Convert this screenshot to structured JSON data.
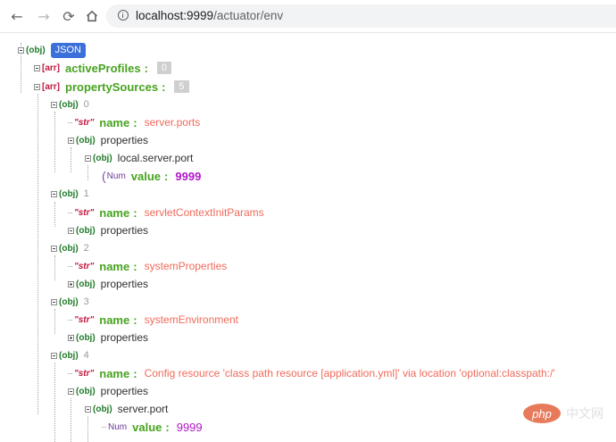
{
  "browser": {
    "back_icon": "arrow-left-icon",
    "forward_icon": "arrow-right-icon",
    "reload_icon": "reload-icon",
    "home_icon": "home-icon",
    "url_host": "localhost:9999",
    "url_path": "/actuator/env"
  },
  "tree": {
    "obj": "(obj)",
    "arr": "[arr]",
    "str": "\"str\"",
    "num": "Num",
    "colon": ":",
    "root_label": "JSON",
    "active_profiles_key": "activeProfiles",
    "active_profiles_count": "0",
    "property_sources_key": "propertySources",
    "property_sources_count": "5",
    "properties_label": "properties",
    "name_key": "name",
    "value_key": "value",
    "sources": [
      {
        "index": "0",
        "name": "server.ports",
        "prop_key": "local.server.port",
        "value": "9999"
      },
      {
        "index": "1",
        "name": "servletContextInitParams"
      },
      {
        "index": "2",
        "name": "systemProperties"
      },
      {
        "index": "3",
        "name": "systemEnvironment"
      },
      {
        "index": "4",
        "name": "Config resource 'class path resource [application.yml]' via location 'optional:classpath:/'",
        "prop_key": "server.port",
        "value": "9999"
      }
    ]
  },
  "watermark": {
    "logo": "php",
    "site": "中文网"
  },
  "colors": {
    "key_green": "#47a31f",
    "string_value": "#f06a5b",
    "number_value": "#b118c8",
    "badge_blue": "#3b6fd9"
  }
}
